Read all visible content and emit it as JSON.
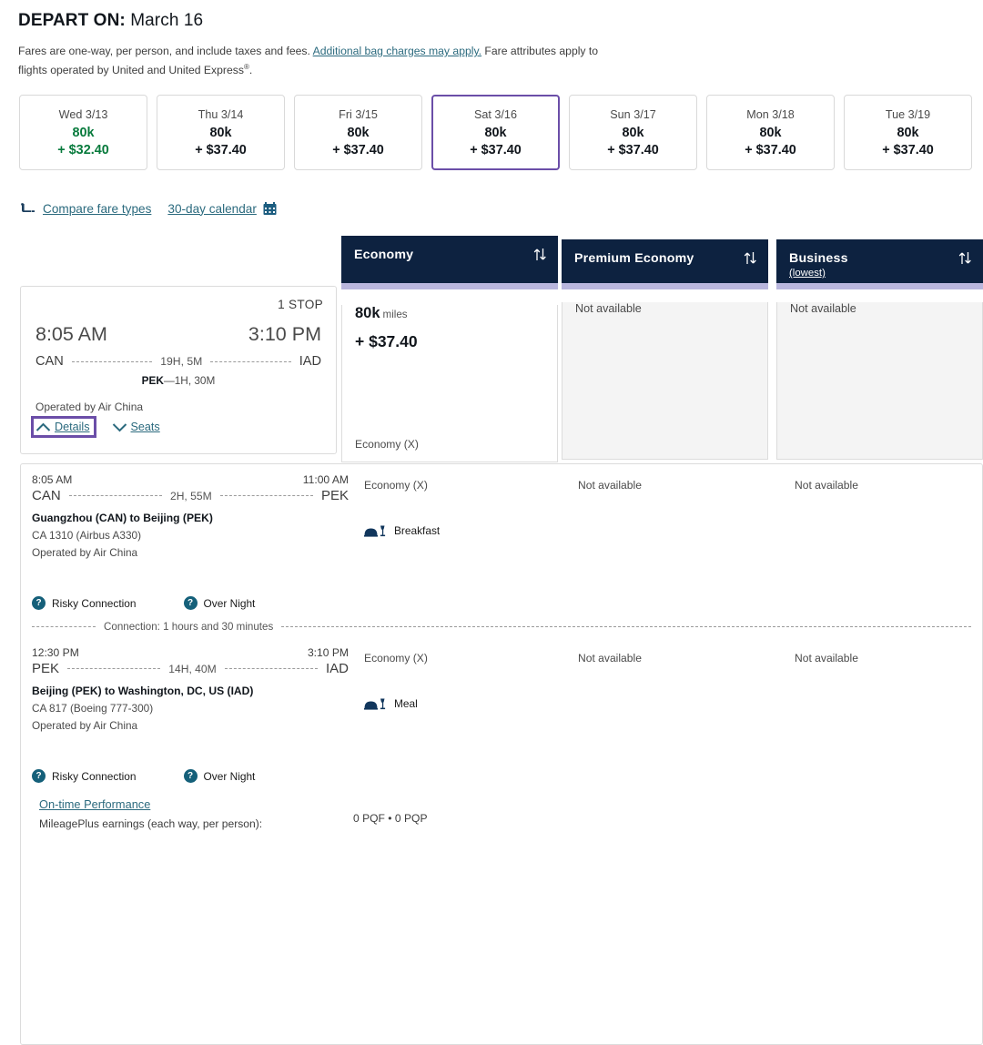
{
  "header": {
    "depart_label": "DEPART ON:",
    "depart_date": "March 16",
    "note_part1": "Fares are one-way, per person, and include taxes and fees.",
    "note_link": "Additional bag charges may apply.",
    "note_part2": "Fare attributes apply to flights operated by United and United Express",
    "note_sup": "®",
    "note_end": "."
  },
  "date_strip": [
    {
      "dow": "Wed 3/13",
      "miles": "80k",
      "cash": "+ $32.40",
      "lowest": true,
      "selected": false
    },
    {
      "dow": "Thu 3/14",
      "miles": "80k",
      "cash": "+ $37.40",
      "lowest": false,
      "selected": false
    },
    {
      "dow": "Fri 3/15",
      "miles": "80k",
      "cash": "+ $37.40",
      "lowest": false,
      "selected": false
    },
    {
      "dow": "Sat 3/16",
      "miles": "80k",
      "cash": "+ $37.40",
      "lowest": false,
      "selected": true
    },
    {
      "dow": "Sun 3/17",
      "miles": "80k",
      "cash": "+ $37.40",
      "lowest": false,
      "selected": false
    },
    {
      "dow": "Mon 3/18",
      "miles": "80k",
      "cash": "+ $37.40",
      "lowest": false,
      "selected": false
    },
    {
      "dow": "Tue 3/19",
      "miles": "80k",
      "cash": "+ $37.40",
      "lowest": false,
      "selected": false
    }
  ],
  "links": {
    "compare_fare_types": "Compare fare types",
    "calendar": "30-day calendar",
    "seat_icon": "seat-icon",
    "calendar_icon": "calendar-icon"
  },
  "cabins": [
    {
      "name": "Economy",
      "sub": "",
      "available": true,
      "na_text": "",
      "miles": "80k",
      "miles_unit": "miles",
      "cash": "+ $37.40",
      "fare_class": "Economy (X)"
    },
    {
      "name": "Premium Economy",
      "sub": "",
      "available": false,
      "na_text": "Not available",
      "miles": "",
      "miles_unit": "",
      "cash": "",
      "fare_class": ""
    },
    {
      "name": "Business",
      "sub": "(lowest)",
      "available": false,
      "na_text": "Not available",
      "miles": "",
      "miles_unit": "",
      "cash": "",
      "fare_class": ""
    }
  ],
  "itinerary": {
    "stops": "1 STOP",
    "depart_time": "8:05 AM",
    "arrive_time": "3:10 PM",
    "origin": "CAN",
    "destination": "IAD",
    "duration": "19H, 5M",
    "stopover_code": "PEK",
    "stopover_sep": "—",
    "stopover_dur": "1H, 30M",
    "operated": "Operated by Air China",
    "details_label": "Details",
    "seats_label": "Seats"
  },
  "legs": [
    {
      "depart_time": "8:05 AM",
      "arrive_time": "11:00 AM",
      "origin": "CAN",
      "destination": "PEK",
      "duration": "2H, 55M",
      "route": "Guangzhou (CAN) to Beijing (PEK)",
      "equipment": "CA 1310 (Airbus A330)",
      "operated": "Operated by Air China",
      "flags": [
        "Risky Connection",
        "Over Night"
      ],
      "cabin_cells": [
        "Economy (X)",
        "Not available",
        "Not available"
      ],
      "meal": "Breakfast"
    },
    {
      "depart_time": "12:30 PM",
      "arrive_time": "3:10 PM",
      "origin": "PEK",
      "destination": "IAD",
      "duration": "14H, 40M",
      "route": "Beijing (PEK) to Washington, DC, US (IAD)",
      "equipment": "CA 817 (Boeing 777-300)",
      "operated": "Operated by Air China",
      "flags": [
        "Risky Connection",
        "Over Night"
      ],
      "cabin_cells": [
        "Economy (X)",
        "Not available",
        "Not available"
      ],
      "meal": "Meal"
    }
  ],
  "connection": {
    "text": "Connection: 1 hours and 30 minutes"
  },
  "footer": {
    "otp_link": "On-time Performance",
    "mileage_label": "MileagePlus earnings (each way, per person):",
    "pq_value": "0 PQF • 0 PQP"
  },
  "colors": {
    "navy": "#0d2240",
    "teal_link": "#2b6a7e",
    "purple_focus": "#6b4ea8",
    "lavender_bar": "#b9b6dd",
    "green_low": "#077a3c",
    "badge_teal": "#15607a"
  }
}
